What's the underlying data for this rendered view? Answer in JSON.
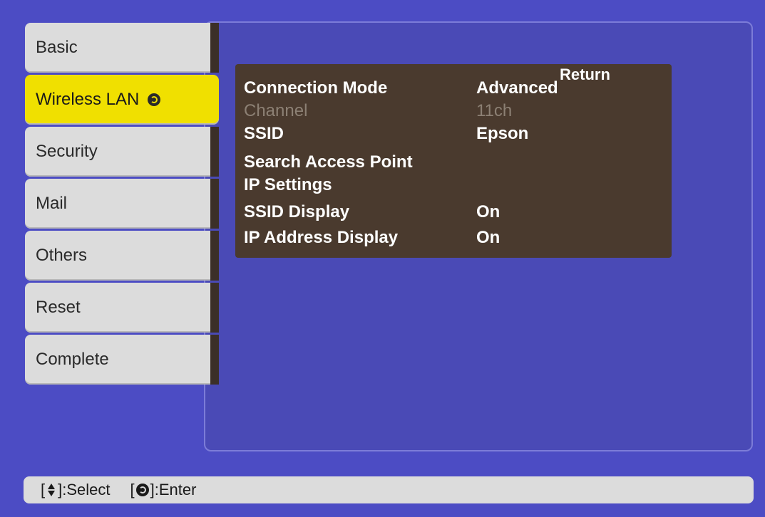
{
  "tabs": [
    {
      "label": "Basic",
      "selected": false
    },
    {
      "label": "Wireless LAN",
      "selected": true
    },
    {
      "label": "Security",
      "selected": false
    },
    {
      "label": "Mail",
      "selected": false
    },
    {
      "label": "Others",
      "selected": false
    },
    {
      "label": "Reset",
      "selected": false
    },
    {
      "label": "Complete",
      "selected": false
    }
  ],
  "settings": {
    "return_label": "Return",
    "rows": [
      {
        "label": "Connection Mode",
        "value": "Advanced",
        "enabled": true
      },
      {
        "label": "Channel",
        "value": "11ch",
        "enabled": false
      },
      {
        "label": "SSID",
        "value": "Epson",
        "enabled": true
      },
      {
        "label": "Search Access Point",
        "value": "",
        "enabled": true
      },
      {
        "label": "IP Settings",
        "value": "",
        "enabled": true
      },
      {
        "label": "SSID Display",
        "value": "On",
        "enabled": true
      },
      {
        "label": "IP Address Display",
        "value": "On",
        "enabled": true
      }
    ]
  },
  "footer": {
    "select_open": "[",
    "select_close": "]:Select",
    "enter_open": "[",
    "enter_close": "]:Enter"
  },
  "colors": {
    "background": "#4c4cc4",
    "tab_selected": "#f0e000",
    "tab_default": "#dcdcdc",
    "settings_box": "#4a3a2e",
    "disabled_text": "#8c8074"
  }
}
